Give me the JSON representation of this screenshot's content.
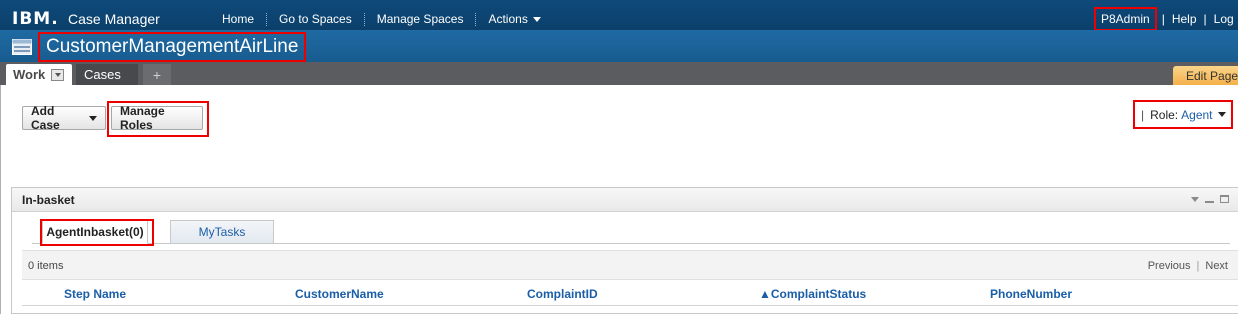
{
  "header": {
    "brand": "IBM.",
    "app_name": "Case Manager",
    "nav": [
      "Home",
      "Go to Spaces",
      "Manage Spaces",
      "Actions"
    ],
    "user": "P8Admin",
    "help": "Help",
    "logout": "Log"
  },
  "solution": {
    "title": "CustomerManagementAirLine"
  },
  "tabs": {
    "work": "Work",
    "cases": "Cases",
    "add": "+",
    "edit_page": "Edit Page"
  },
  "toolbar": {
    "add_case": "Add Case",
    "manage_roles": "Manage Roles"
  },
  "role": {
    "separator": "|",
    "label": "Role:",
    "value": "Agent"
  },
  "inbasket": {
    "title": "In-basket",
    "subtabs": [
      "AgentInbasket(0)",
      "MyTasks"
    ],
    "items_count": "0 items",
    "pager": {
      "previous": "Previous",
      "separator": "|",
      "next": "Next"
    },
    "columns": [
      "Step Name",
      "CustomerName",
      "ComplaintID",
      "▲ComplaintStatus",
      "PhoneNumber"
    ]
  },
  "colors": {
    "banner": "#0e4a7b",
    "solution_bar": "#1f6aa3",
    "tabs_bar": "#5a5c60",
    "link": "#1a5ea8",
    "highlight": "#ee0000",
    "edit_page": "#f4b04a"
  }
}
